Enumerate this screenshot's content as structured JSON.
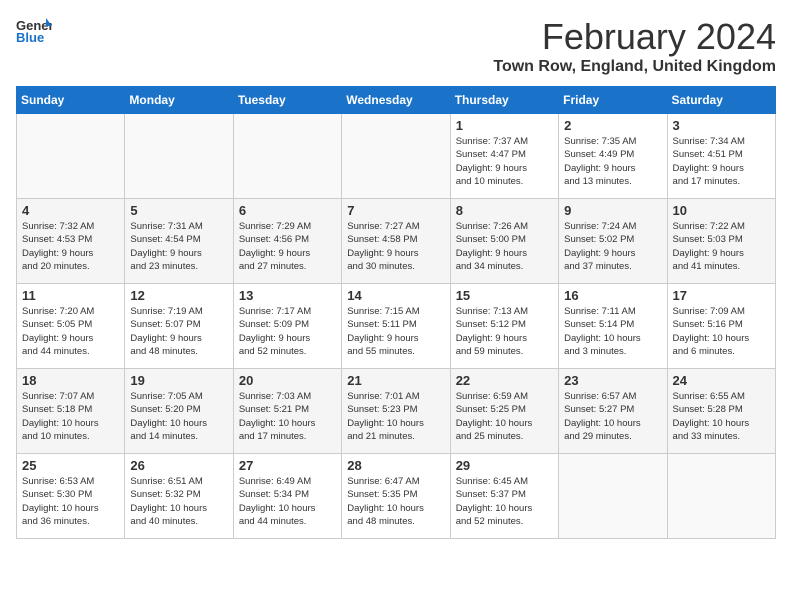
{
  "logo": {
    "line1": "General",
    "line2": "Blue"
  },
  "title": "February 2024",
  "location": "Town Row, England, United Kingdom",
  "weekdays": [
    "Sunday",
    "Monday",
    "Tuesday",
    "Wednesday",
    "Thursday",
    "Friday",
    "Saturday"
  ],
  "weeks": [
    [
      {
        "day": "",
        "info": ""
      },
      {
        "day": "",
        "info": ""
      },
      {
        "day": "",
        "info": ""
      },
      {
        "day": "",
        "info": ""
      },
      {
        "day": "1",
        "info": "Sunrise: 7:37 AM\nSunset: 4:47 PM\nDaylight: 9 hours\nand 10 minutes."
      },
      {
        "day": "2",
        "info": "Sunrise: 7:35 AM\nSunset: 4:49 PM\nDaylight: 9 hours\nand 13 minutes."
      },
      {
        "day": "3",
        "info": "Sunrise: 7:34 AM\nSunset: 4:51 PM\nDaylight: 9 hours\nand 17 minutes."
      }
    ],
    [
      {
        "day": "4",
        "info": "Sunrise: 7:32 AM\nSunset: 4:53 PM\nDaylight: 9 hours\nand 20 minutes."
      },
      {
        "day": "5",
        "info": "Sunrise: 7:31 AM\nSunset: 4:54 PM\nDaylight: 9 hours\nand 23 minutes."
      },
      {
        "day": "6",
        "info": "Sunrise: 7:29 AM\nSunset: 4:56 PM\nDaylight: 9 hours\nand 27 minutes."
      },
      {
        "day": "7",
        "info": "Sunrise: 7:27 AM\nSunset: 4:58 PM\nDaylight: 9 hours\nand 30 minutes."
      },
      {
        "day": "8",
        "info": "Sunrise: 7:26 AM\nSunset: 5:00 PM\nDaylight: 9 hours\nand 34 minutes."
      },
      {
        "day": "9",
        "info": "Sunrise: 7:24 AM\nSunset: 5:02 PM\nDaylight: 9 hours\nand 37 minutes."
      },
      {
        "day": "10",
        "info": "Sunrise: 7:22 AM\nSunset: 5:03 PM\nDaylight: 9 hours\nand 41 minutes."
      }
    ],
    [
      {
        "day": "11",
        "info": "Sunrise: 7:20 AM\nSunset: 5:05 PM\nDaylight: 9 hours\nand 44 minutes."
      },
      {
        "day": "12",
        "info": "Sunrise: 7:19 AM\nSunset: 5:07 PM\nDaylight: 9 hours\nand 48 minutes."
      },
      {
        "day": "13",
        "info": "Sunrise: 7:17 AM\nSunset: 5:09 PM\nDaylight: 9 hours\nand 52 minutes."
      },
      {
        "day": "14",
        "info": "Sunrise: 7:15 AM\nSunset: 5:11 PM\nDaylight: 9 hours\nand 55 minutes."
      },
      {
        "day": "15",
        "info": "Sunrise: 7:13 AM\nSunset: 5:12 PM\nDaylight: 9 hours\nand 59 minutes."
      },
      {
        "day": "16",
        "info": "Sunrise: 7:11 AM\nSunset: 5:14 PM\nDaylight: 10 hours\nand 3 minutes."
      },
      {
        "day": "17",
        "info": "Sunrise: 7:09 AM\nSunset: 5:16 PM\nDaylight: 10 hours\nand 6 minutes."
      }
    ],
    [
      {
        "day": "18",
        "info": "Sunrise: 7:07 AM\nSunset: 5:18 PM\nDaylight: 10 hours\nand 10 minutes."
      },
      {
        "day": "19",
        "info": "Sunrise: 7:05 AM\nSunset: 5:20 PM\nDaylight: 10 hours\nand 14 minutes."
      },
      {
        "day": "20",
        "info": "Sunrise: 7:03 AM\nSunset: 5:21 PM\nDaylight: 10 hours\nand 17 minutes."
      },
      {
        "day": "21",
        "info": "Sunrise: 7:01 AM\nSunset: 5:23 PM\nDaylight: 10 hours\nand 21 minutes."
      },
      {
        "day": "22",
        "info": "Sunrise: 6:59 AM\nSunset: 5:25 PM\nDaylight: 10 hours\nand 25 minutes."
      },
      {
        "day": "23",
        "info": "Sunrise: 6:57 AM\nSunset: 5:27 PM\nDaylight: 10 hours\nand 29 minutes."
      },
      {
        "day": "24",
        "info": "Sunrise: 6:55 AM\nSunset: 5:28 PM\nDaylight: 10 hours\nand 33 minutes."
      }
    ],
    [
      {
        "day": "25",
        "info": "Sunrise: 6:53 AM\nSunset: 5:30 PM\nDaylight: 10 hours\nand 36 minutes."
      },
      {
        "day": "26",
        "info": "Sunrise: 6:51 AM\nSunset: 5:32 PM\nDaylight: 10 hours\nand 40 minutes."
      },
      {
        "day": "27",
        "info": "Sunrise: 6:49 AM\nSunset: 5:34 PM\nDaylight: 10 hours\nand 44 minutes."
      },
      {
        "day": "28",
        "info": "Sunrise: 6:47 AM\nSunset: 5:35 PM\nDaylight: 10 hours\nand 48 minutes."
      },
      {
        "day": "29",
        "info": "Sunrise: 6:45 AM\nSunset: 5:37 PM\nDaylight: 10 hours\nand 52 minutes."
      },
      {
        "day": "",
        "info": ""
      },
      {
        "day": "",
        "info": ""
      }
    ]
  ]
}
